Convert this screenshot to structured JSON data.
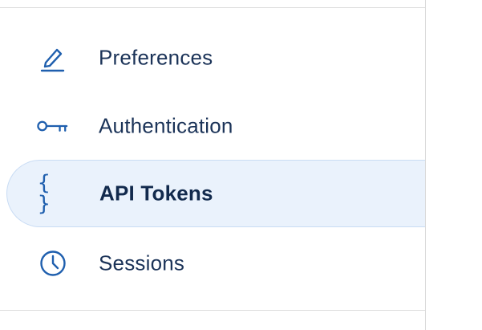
{
  "settings_nav": {
    "items": [
      {
        "label": "Preferences",
        "icon": "pencil-icon",
        "active": false
      },
      {
        "label": "Authentication",
        "icon": "key-icon",
        "active": false
      },
      {
        "label": "API Tokens",
        "icon": "braces-icon",
        "icon_text": "{ }",
        "active": true
      },
      {
        "label": "Sessions",
        "icon": "clock-icon",
        "active": false
      }
    ]
  },
  "colors": {
    "icon": "#1f5fae",
    "label": "#1b3358",
    "active_bg": "#eaf2fc",
    "active_border": "#c9dcf4",
    "divider": "#dedede"
  }
}
